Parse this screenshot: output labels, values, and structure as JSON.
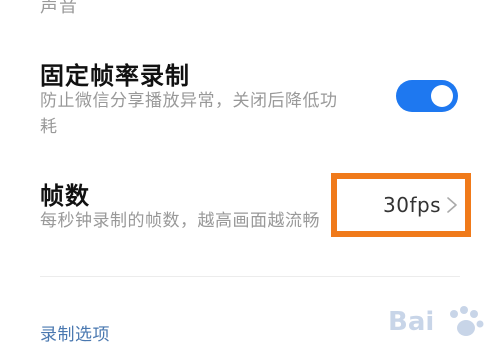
{
  "top_partial_label": "声音",
  "fixed_fps": {
    "title": "固定帧率录制",
    "description_line1": "防止微信分享播放异常，关闭后降低功",
    "description_line2": "耗",
    "toggle_on": true,
    "toggle_color": "#1e78f0"
  },
  "fps": {
    "title": "帧数",
    "description": "每秒钟录制的帧数，越高画面越流畅",
    "value": "30fps",
    "highlight_color": "#f07a1a"
  },
  "section": {
    "title": "录制选项"
  },
  "watermark": {
    "text": "Bai",
    "icon": "baidu-paw-icon"
  }
}
